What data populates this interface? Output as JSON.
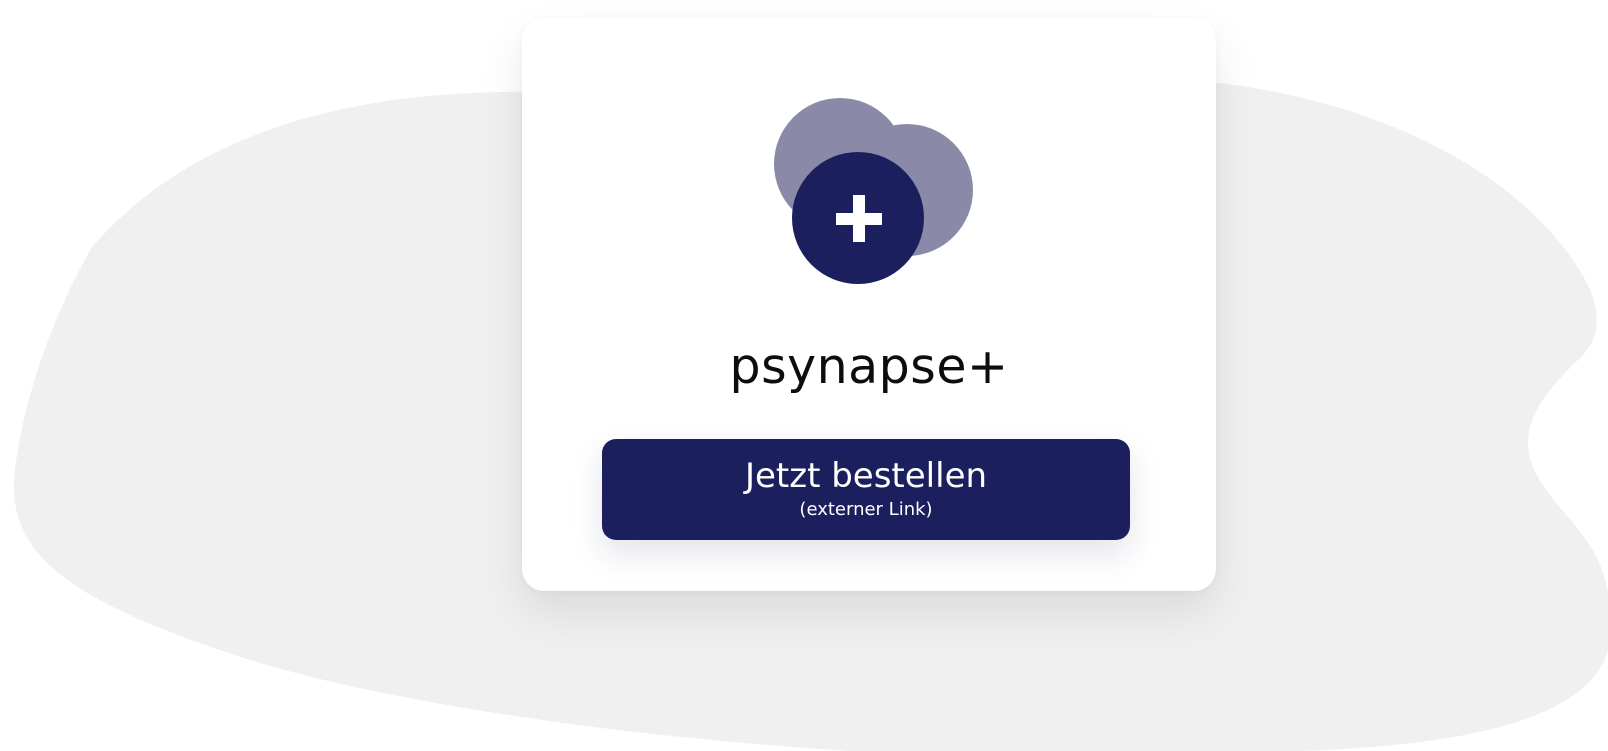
{
  "product": {
    "name": "psynapse+"
  },
  "cta": {
    "label": "Jetzt bestellen",
    "sublabel": "(externer Link)"
  },
  "colors": {
    "brand": "#1c1f5e",
    "brand_light": "#8a8aa8",
    "background_blob": "#f0f0f0",
    "card": "#ffffff"
  },
  "icons": {
    "logo": "circles-plus-icon"
  }
}
